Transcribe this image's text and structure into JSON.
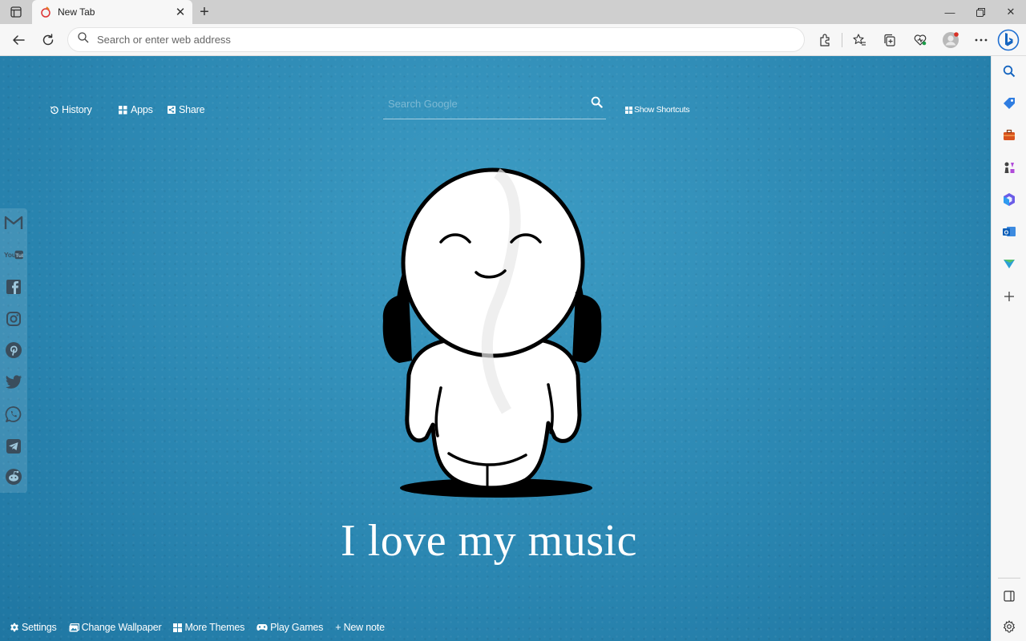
{
  "browser": {
    "tab": {
      "title": "New Tab",
      "close": "✕"
    },
    "new_tab": "+",
    "address_bar": {
      "placeholder": "Search or enter web address",
      "value": ""
    },
    "toolbar_icons": [
      "extensions-icon",
      "favorites-icon",
      "collections-icon",
      "browser-essentials-icon",
      "profile-icon",
      "more-icon"
    ],
    "sidebar_icons": [
      "search-icon",
      "shopping-icon",
      "tools-icon",
      "games-icon",
      "microsoft-365-icon",
      "outlook-icon",
      "drop-icon",
      "add-icon"
    ],
    "accent": "#0f6cbd"
  },
  "newtab": {
    "links": {
      "history": "History",
      "apps": "Apps",
      "share": "Share"
    },
    "search": {
      "placeholder": "Search Google"
    },
    "shortcuts": "Show Shortcuts",
    "social": [
      "gmail-icon",
      "youtube-icon",
      "facebook-icon",
      "instagram-icon",
      "pinterest-icon",
      "twitter-icon",
      "whatsapp-icon",
      "telegram-icon",
      "reddit-icon"
    ],
    "tagline": "I love my music",
    "bottom": {
      "settings": "Settings",
      "change_wallpaper": "Change Wallpaper",
      "more_themes": "More Themes",
      "play_games": "Play Games",
      "new_note": "+ New note"
    },
    "background": "#2a86b1"
  }
}
